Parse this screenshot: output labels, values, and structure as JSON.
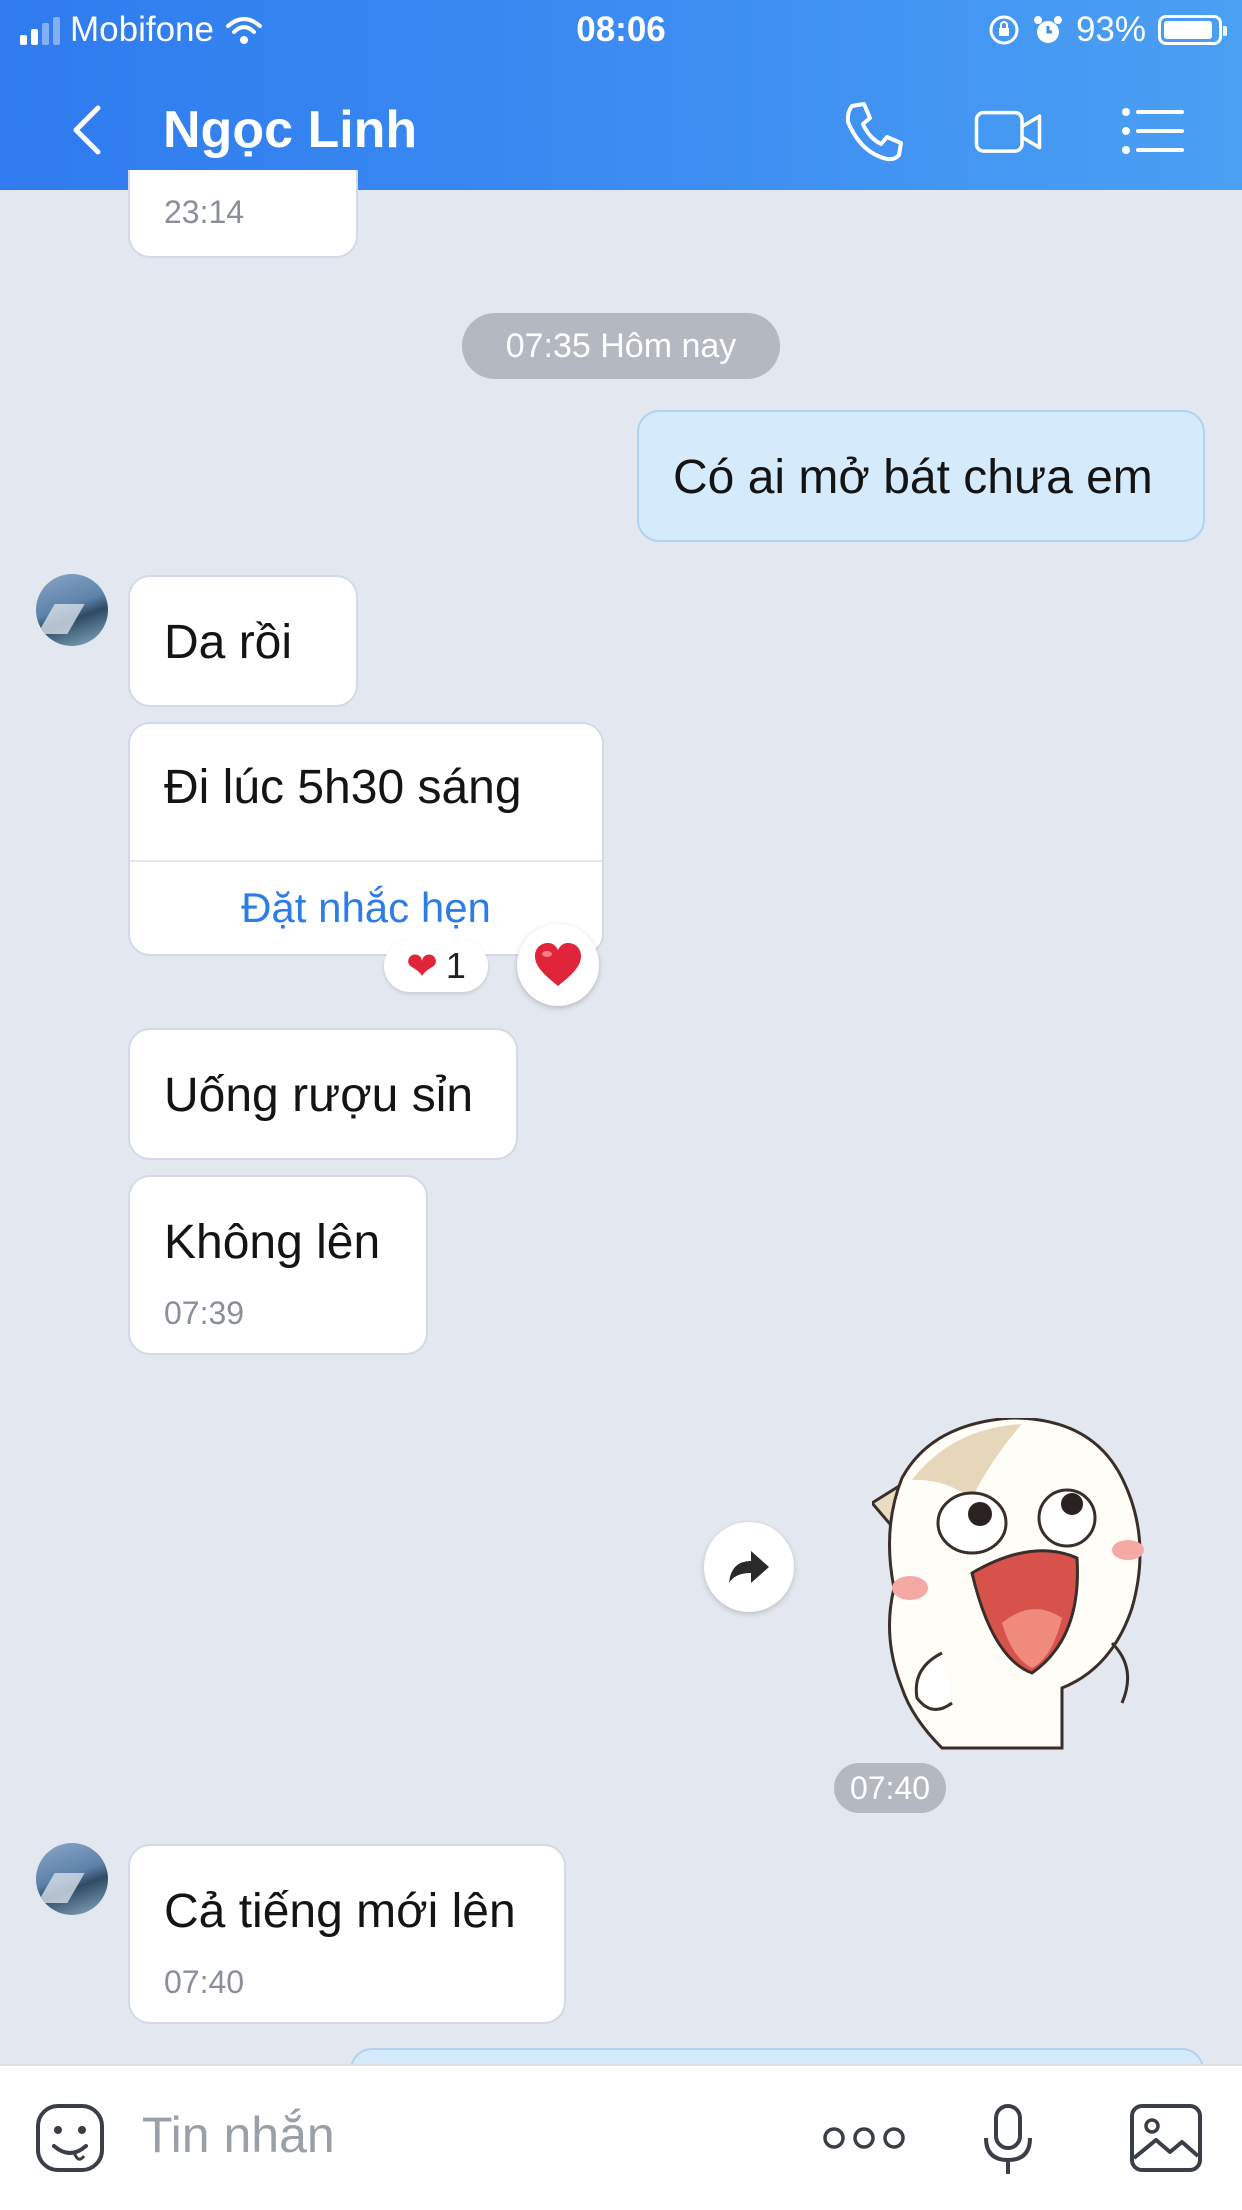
{
  "status_bar": {
    "carrier": "Mobifone",
    "time": "08:06",
    "battery": "93%",
    "battery_level": 0.93
  },
  "header": {
    "contact_name": "Ngọc Linh",
    "icons": [
      "back-icon",
      "phone-icon",
      "video-camera-icon",
      "menu-list-icon"
    ]
  },
  "chat": {
    "top_partial_ts": "23:14",
    "day_separator": "07:35 Hôm nay",
    "messages": [
      {
        "from": "me",
        "text": "Có ai mở bát chưa em"
      },
      {
        "from": "contact",
        "text": "Da rồi"
      },
      {
        "from": "contact",
        "text": "Đi lúc 5h30 sáng",
        "action": "Đặt nhắc hẹn",
        "reaction": "❤",
        "reaction_count": "1"
      },
      {
        "from": "contact",
        "text": "Uống rượu sỉn"
      },
      {
        "from": "contact",
        "text": "Không lên",
        "time": "07:39"
      },
      {
        "from": "me",
        "sticker": "laughing-cat-sticker",
        "time": "07:40"
      },
      {
        "from": "contact",
        "text": "Cả tiếng mới lên",
        "time": "07:40"
      }
    ]
  },
  "composer": {
    "placeholder": "Tin nhắn",
    "icons": [
      "sticker-icon",
      "more-dots-icon",
      "microphone-icon",
      "image-icon"
    ]
  },
  "colors": {
    "header_start": "#2f7bef",
    "header_end": "#4aa0f3",
    "chat_bg": "#e3e7ef",
    "my_bubble": "#d5ebfb",
    "link": "#2e7de6"
  }
}
